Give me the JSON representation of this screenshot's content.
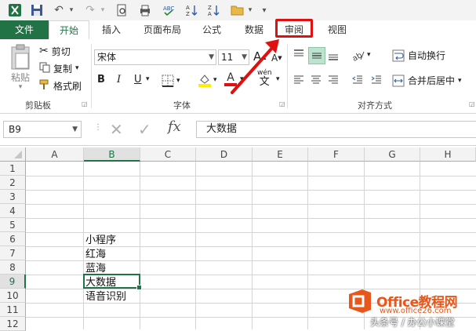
{
  "ribbon_tabs": [
    "文件",
    "开始",
    "插入",
    "页面布局",
    "公式",
    "数据",
    "审阅",
    "视图"
  ],
  "clipboard": {
    "paste": "粘贴",
    "cut": "剪切",
    "copy": "复制",
    "format_painter": "格式刷",
    "group": "剪贴板"
  },
  "font": {
    "name": "宋体",
    "size": "11",
    "bold": "B",
    "italic": "I",
    "underline": "U",
    "wen": "wén",
    "group": "字体"
  },
  "alignment": {
    "wrap_text": "自动换行",
    "merge_center": "合并后居中",
    "group": "对齐方式"
  },
  "formula_bar": {
    "name_box": "B9",
    "fx": "fx",
    "content": "大数据"
  },
  "columns": [
    "A",
    "B",
    "C",
    "D",
    "E",
    "F",
    "G",
    "H"
  ],
  "rows": [
    "1",
    "2",
    "3",
    "4",
    "5",
    "6",
    "7",
    "8",
    "9",
    "10",
    "11",
    "12"
  ],
  "cells": [
    {
      "row": "6",
      "col": "B",
      "value": "小程序"
    },
    {
      "row": "7",
      "col": "B",
      "value": "红海"
    },
    {
      "row": "8",
      "col": "B",
      "value": "蓝海"
    },
    {
      "row": "9",
      "col": "B",
      "value": "大数据"
    },
    {
      "row": "10",
      "col": "B",
      "value": "语音识别"
    }
  ],
  "active_cell": "B9",
  "watermark": {
    "brand": "Office教程网",
    "url": "www.office26.com",
    "author": "头条号 / 办公小课堂"
  },
  "colors": {
    "accent": "#217346",
    "highlight": "#e01010",
    "watermark_orange": "#e8561a"
  }
}
